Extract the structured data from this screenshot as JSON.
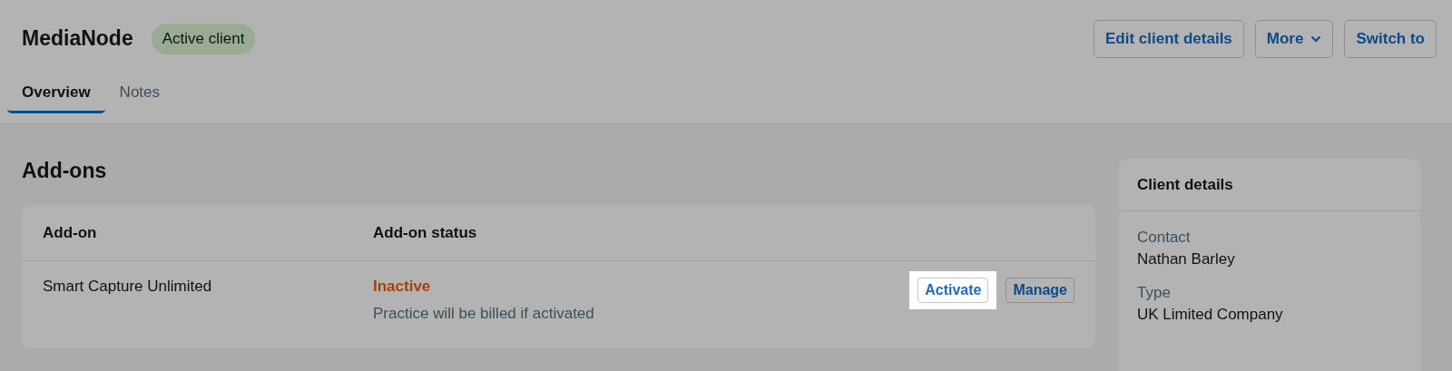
{
  "client": {
    "name": "MediaNode",
    "status_badge": "Active client"
  },
  "header_buttons": [
    {
      "label": "Edit client details",
      "kind": "plain"
    },
    {
      "label": "More",
      "kind": "dropdown"
    },
    {
      "label": "Switch to",
      "kind": "plain"
    }
  ],
  "tabs": [
    {
      "label": "Overview",
      "selected": true
    },
    {
      "label": "Notes",
      "selected": false
    }
  ],
  "addons": {
    "title": "Add-ons",
    "columns": [
      "Add-on",
      "Add-on status"
    ],
    "rows": [
      {
        "name": "Smart Capture Unlimited",
        "status": "Inactive",
        "note": "Practice will be billed if activated",
        "actions": [
          {
            "label": "Activate",
            "highlighted": true
          },
          {
            "label": "Manage",
            "highlighted": false
          }
        ]
      }
    ]
  },
  "client_details": {
    "title": "Client details",
    "fields": [
      {
        "label": "Contact",
        "value": "Nathan Barley"
      },
      {
        "label": "Type",
        "value": "UK Limited Company"
      }
    ]
  }
}
